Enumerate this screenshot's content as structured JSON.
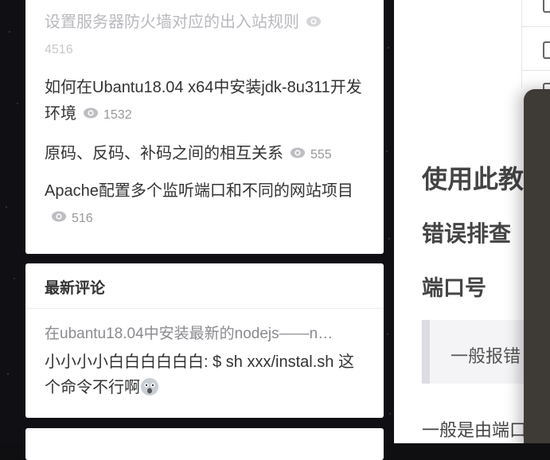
{
  "sidebar": {
    "popular_posts": [
      {
        "title": "设置服务器防火墙对应的出入站规则",
        "views": "4516",
        "faded": true
      },
      {
        "title": "如何在Ubantu18.04 x64中安装jdk-8u311开发环境",
        "views": "1532",
        "faded": false
      },
      {
        "title": "原码、反码、补码之间的相互关系",
        "views": "555",
        "faded": false
      },
      {
        "title": "Apache配置多个监听端口和不同的网站项目",
        "views": "516",
        "faded": false
      }
    ],
    "latest_comments": {
      "title": "最新评论",
      "items": [
        {
          "post": "在ubantu18.04中安装最新的nodejs——n…",
          "text": "小小小小白白白白白白: $ sh xxx/instal.sh 这个命令不行啊",
          "emoji": "shocked-emoji-icon"
        }
      ]
    }
  },
  "article": {
    "heading_1": "使用此教",
    "heading_2": "错误排查",
    "heading_3": "端口号",
    "quote": "一般报错",
    "paragraph": "一般是由端口"
  },
  "colors": {
    "page_bg": "#101014",
    "card_bg": "#ffffff",
    "text": "#333333",
    "muted": "#999999",
    "panel": "#3e3b37"
  }
}
